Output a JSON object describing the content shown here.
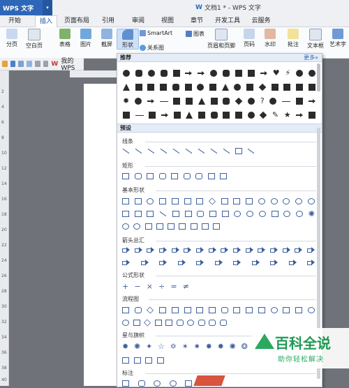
{
  "app": {
    "name": "WPS 文字",
    "dropdown": "▾"
  },
  "window": {
    "title": "文档1 * - WPS 文字",
    "icon": "W"
  },
  "menu": {
    "tabs": [
      "开始",
      "插入",
      "页面布局",
      "引用",
      "审阅",
      "视图",
      "章节",
      "开发工具",
      "云服务"
    ],
    "active": 1
  },
  "ribbon": {
    "buttons": [
      "分页",
      "空白页",
      "表格",
      "图片",
      "截屏",
      "形状",
      "页眉和页脚",
      "页码",
      "水印",
      "批注",
      "文本框",
      "艺术字"
    ],
    "smartart": "SmartArt",
    "chart": "图表",
    "relation": "关系图"
  },
  "quickbar": {
    "doc_tab": "我的WPS"
  },
  "gallery": {
    "recommend": "推荐",
    "more": "更多»",
    "preset": "预设",
    "categories": [
      "线条",
      "矩形",
      "基本形状",
      "箭头总汇",
      "公式形状",
      "流程图",
      "星与旗帜",
      "标注"
    ]
  },
  "ruler": {
    "numbers": [
      "2",
      "4",
      "6",
      "8",
      "10",
      "12",
      "14",
      "16",
      "18",
      "20",
      "22",
      "24",
      "26",
      "28",
      "30",
      "32",
      "34",
      "36",
      "38",
      "40"
    ]
  },
  "watermark": {
    "title": "百科全说",
    "subtitle": "助你轻松解决"
  },
  "colors": {
    "brand": "#2e67b8",
    "accent": "#1e9a53",
    "shape_outline": "#3d5f9e"
  }
}
